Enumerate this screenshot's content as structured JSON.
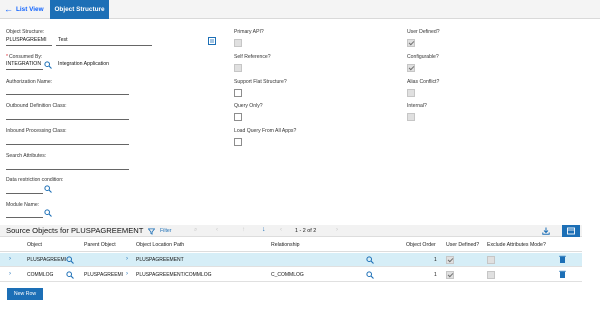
{
  "tabs": {
    "back_label": "List View",
    "active_label": "Object Structure"
  },
  "form": {
    "object_structure": {
      "label": "Object Structure:",
      "value": "PLUSPAGREEMI",
      "description": "Test"
    },
    "consumed_by": {
      "label": "Consumed By:",
      "value": "INTEGRATION",
      "description": "Integration Application"
    },
    "authorization_name": {
      "label": "Authorization Name:"
    },
    "outbound_class": {
      "label": "Outbound Definition Class:"
    },
    "inbound_class": {
      "label": "Inbound Processing Class:"
    },
    "search_attributes": {
      "label": "Search Attributes:"
    },
    "data_restriction": {
      "label": "Data restriction condition:"
    },
    "module_name": {
      "label": "Module Name:"
    },
    "primary_api": {
      "label": "Primary API?",
      "checked": false
    },
    "self_reference": {
      "label": "Self Reference?",
      "checked": false
    },
    "support_flat": {
      "label": "Support Flat Structure?",
      "checked": false
    },
    "query_only": {
      "label": "Query Only?",
      "checked": false
    },
    "load_query": {
      "label": "Load Query From All Apps?",
      "checked": false
    },
    "user_defined": {
      "label": "User Defined?",
      "checked": true
    },
    "configurable": {
      "label": "Configurable?",
      "checked": true
    },
    "alias_conflict": {
      "label": "Alias Conflict?",
      "checked": false
    },
    "internal": {
      "label": "Internal?",
      "checked": false
    }
  },
  "table": {
    "title": "Source Objects for PLUSPAGREEMENT",
    "filter_label": "Filter",
    "pagination": "1 - 2 of 2",
    "columns": [
      "Object",
      "Parent Object",
      "Object Location Path",
      "Relationship",
      "Object Order",
      "User Defined?",
      "Exclude Attributes Mode?"
    ],
    "rows": [
      {
        "object": "PLUSPAGREEMI",
        "parent": "",
        "path": "PLUSPAGREEMENT",
        "relationship": "",
        "order": "1",
        "user_defined": true,
        "exclude": false
      },
      {
        "object": "COMMLOG",
        "parent": "PLUSPAGREEMI",
        "path": "PLUSPAGREEMENT/COMMLOG",
        "relationship": "C_COMMLOG",
        "order": "1",
        "user_defined": true,
        "exclude": false
      }
    ],
    "new_row_label": "New Row"
  },
  "colors": {
    "accent": "#1c6fb6",
    "link": "#0f62fe",
    "selected_row": "#d6eef7"
  }
}
